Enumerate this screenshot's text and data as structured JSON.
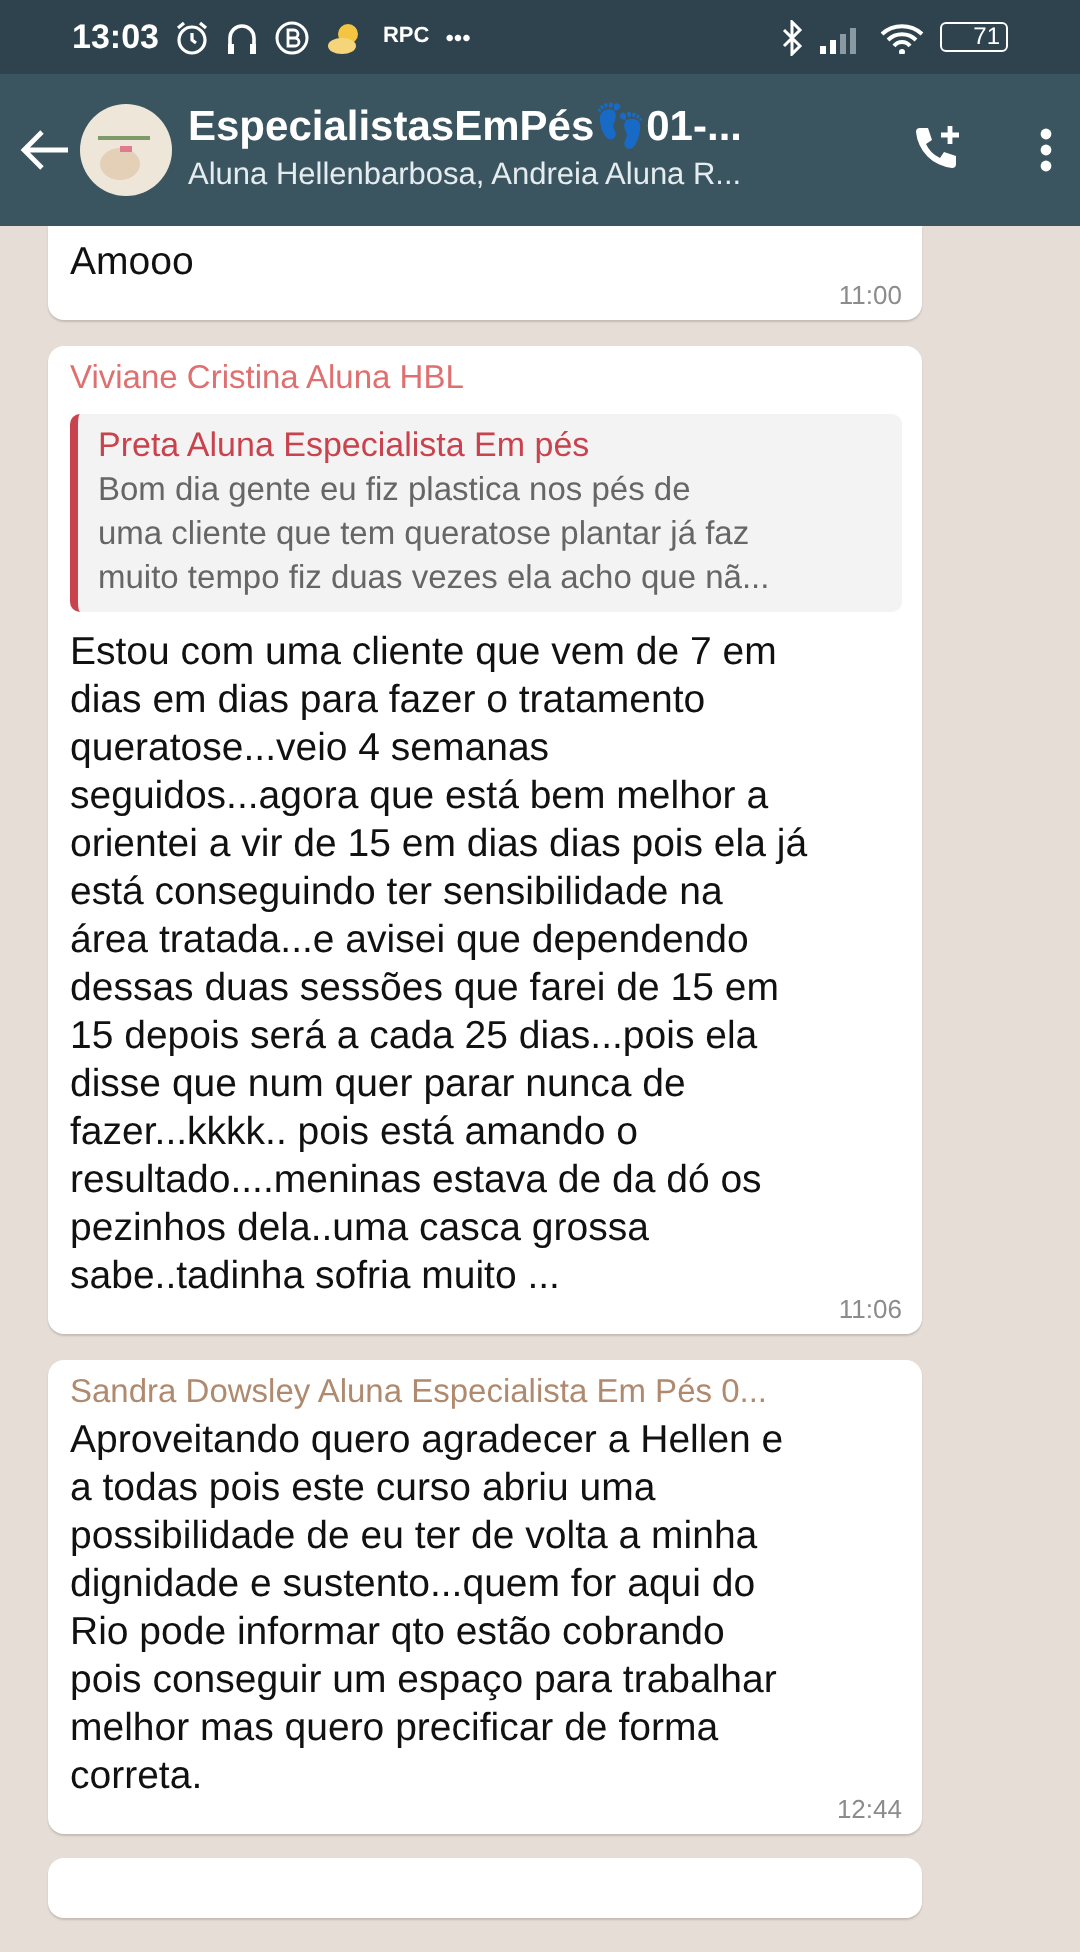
{
  "status_bar": {
    "time": "13:03",
    "carrier_text": "RPC",
    "more": "•••",
    "battery": "71"
  },
  "header": {
    "title": "EspecialistasEmPés👣01-...",
    "subtitle": "Aluna Hellenbarbosa, Andreia Aluna R..."
  },
  "messages": [
    {
      "kind": "plain",
      "text": "Amooo",
      "time": "11:00"
    },
    {
      "kind": "reply",
      "sender": "Viviane Cristina Aluna HBL",
      "color": "#e0706f",
      "quote": {
        "sender": "Preta Aluna Especialista Em pés",
        "color": "#c9434e",
        "text": "Bom dia gente eu fiz  plastica  nos pés de\numa cliente que tem queratose plantar já faz\nmuito tempo fiz duas vezes  ela acho que nã..."
      },
      "text": "Estou com uma cliente que vem de 7 em\ndias em dias para fazer o tratamento\nqueratose...veio 4 semanas\nseguidos...agora que está bem melhor a\norientei a vir de 15 em dias dias pois ela já\nestá conseguindo ter sensibilidade na\nárea tratada...e avisei que dependendo\ndessas duas sessões que farei de 15 em\n15 depois será a cada 25 dias...pois ela\ndisse que num quer parar nunca de\nfazer...kkkk.. pois está amando o\nresultado....meninas estava de da dó os\npezinhos dela..uma casca grossa\nsabe..tadinha sofria muito ...",
      "time": "11:06"
    },
    {
      "kind": "named",
      "sender": "Sandra Dowsley Aluna Especialista Em Pés 0...",
      "color": "#b08a6e",
      "text": "Aproveitando quero agradecer a Hellen e\na todas pois este curso abriu uma\npossibilidade de eu ter de volta a minha\ndignidade e sustento...quem for aqui do\nRio pode informar qto estão cobrando\npois conseguir um espaço para trabalhar\nmelhor mas quero precificar de forma\ncorreta.",
      "time": "12:44"
    },
    {
      "kind": "cut"
    }
  ]
}
